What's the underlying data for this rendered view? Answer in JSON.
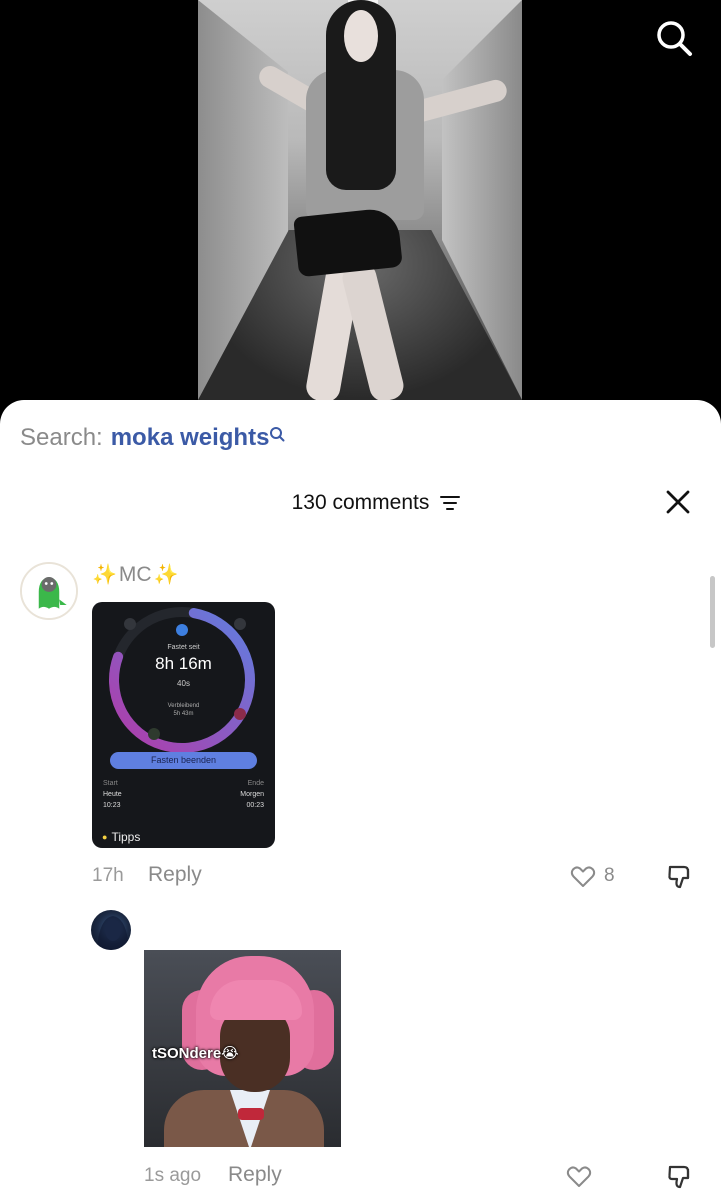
{
  "video": {
    "search_icon": "search-icon"
  },
  "sheet": {
    "search_prefix": "Search:",
    "search_query": "moka weights",
    "comments_count": "130 comments",
    "sort_icon": "sort-icon",
    "close_icon": "close-icon"
  },
  "comments": [
    {
      "username_sparkle_left": "✨",
      "username": "MC",
      "username_sparkle_right": "✨",
      "image": {
        "fastet_label": "Fastet seit",
        "elapsed": "8h 16m",
        "seconds": "40s",
        "remaining_label": "Verbleibend",
        "remaining": "5h 43m",
        "button": "Fasten beenden",
        "start_label": "Start",
        "start_day": "Heute",
        "start_time": "10:23",
        "end_label": "Ende",
        "end_day": "Morgen",
        "end_time": "00:23",
        "tips": "Tipps"
      },
      "time": "17h",
      "reply_label": "Reply",
      "likes": "8"
    },
    {
      "image_caption": "tSONdere😭",
      "time": "1s ago",
      "reply_label": "Reply"
    }
  ],
  "colors": {
    "search_query": "#3b5aa6",
    "muted": "#8a8a8a",
    "ring_start": "#b23aa8",
    "ring_end": "#5f7fe0"
  }
}
